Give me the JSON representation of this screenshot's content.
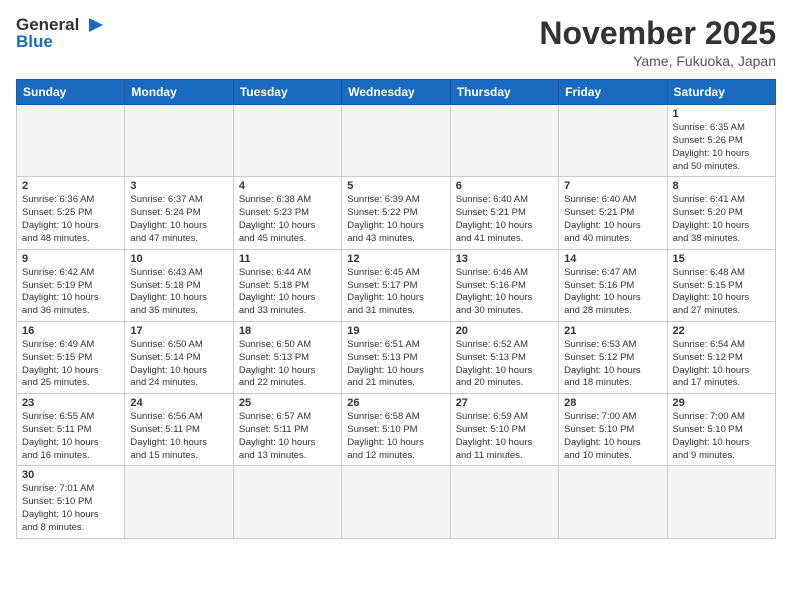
{
  "header": {
    "logo_general": "General",
    "logo_blue": "Blue",
    "title": "November 2025",
    "location": "Yame, Fukuoka, Japan"
  },
  "days_of_week": [
    "Sunday",
    "Monday",
    "Tuesday",
    "Wednesday",
    "Thursday",
    "Friday",
    "Saturday"
  ],
  "weeks": [
    [
      {
        "day": "",
        "info": ""
      },
      {
        "day": "",
        "info": ""
      },
      {
        "day": "",
        "info": ""
      },
      {
        "day": "",
        "info": ""
      },
      {
        "day": "",
        "info": ""
      },
      {
        "day": "",
        "info": ""
      },
      {
        "day": "1",
        "info": "Sunrise: 6:35 AM\nSunset: 5:26 PM\nDaylight: 10 hours\nand 50 minutes."
      }
    ],
    [
      {
        "day": "2",
        "info": "Sunrise: 6:36 AM\nSunset: 5:25 PM\nDaylight: 10 hours\nand 48 minutes."
      },
      {
        "day": "3",
        "info": "Sunrise: 6:37 AM\nSunset: 5:24 PM\nDaylight: 10 hours\nand 47 minutes."
      },
      {
        "day": "4",
        "info": "Sunrise: 6:38 AM\nSunset: 5:23 PM\nDaylight: 10 hours\nand 45 minutes."
      },
      {
        "day": "5",
        "info": "Sunrise: 6:39 AM\nSunset: 5:22 PM\nDaylight: 10 hours\nand 43 minutes."
      },
      {
        "day": "6",
        "info": "Sunrise: 6:40 AM\nSunset: 5:21 PM\nDaylight: 10 hours\nand 41 minutes."
      },
      {
        "day": "7",
        "info": "Sunrise: 6:40 AM\nSunset: 5:21 PM\nDaylight: 10 hours\nand 40 minutes."
      },
      {
        "day": "8",
        "info": "Sunrise: 6:41 AM\nSunset: 5:20 PM\nDaylight: 10 hours\nand 38 minutes."
      }
    ],
    [
      {
        "day": "9",
        "info": "Sunrise: 6:42 AM\nSunset: 5:19 PM\nDaylight: 10 hours\nand 36 minutes."
      },
      {
        "day": "10",
        "info": "Sunrise: 6:43 AM\nSunset: 5:18 PM\nDaylight: 10 hours\nand 35 minutes."
      },
      {
        "day": "11",
        "info": "Sunrise: 6:44 AM\nSunset: 5:18 PM\nDaylight: 10 hours\nand 33 minutes."
      },
      {
        "day": "12",
        "info": "Sunrise: 6:45 AM\nSunset: 5:17 PM\nDaylight: 10 hours\nand 31 minutes."
      },
      {
        "day": "13",
        "info": "Sunrise: 6:46 AM\nSunset: 5:16 PM\nDaylight: 10 hours\nand 30 minutes."
      },
      {
        "day": "14",
        "info": "Sunrise: 6:47 AM\nSunset: 5:16 PM\nDaylight: 10 hours\nand 28 minutes."
      },
      {
        "day": "15",
        "info": "Sunrise: 6:48 AM\nSunset: 5:15 PM\nDaylight: 10 hours\nand 27 minutes."
      }
    ],
    [
      {
        "day": "16",
        "info": "Sunrise: 6:49 AM\nSunset: 5:15 PM\nDaylight: 10 hours\nand 25 minutes."
      },
      {
        "day": "17",
        "info": "Sunrise: 6:50 AM\nSunset: 5:14 PM\nDaylight: 10 hours\nand 24 minutes."
      },
      {
        "day": "18",
        "info": "Sunrise: 6:50 AM\nSunset: 5:13 PM\nDaylight: 10 hours\nand 22 minutes."
      },
      {
        "day": "19",
        "info": "Sunrise: 6:51 AM\nSunset: 5:13 PM\nDaylight: 10 hours\nand 21 minutes."
      },
      {
        "day": "20",
        "info": "Sunrise: 6:52 AM\nSunset: 5:13 PM\nDaylight: 10 hours\nand 20 minutes."
      },
      {
        "day": "21",
        "info": "Sunrise: 6:53 AM\nSunset: 5:12 PM\nDaylight: 10 hours\nand 18 minutes."
      },
      {
        "day": "22",
        "info": "Sunrise: 6:54 AM\nSunset: 5:12 PM\nDaylight: 10 hours\nand 17 minutes."
      }
    ],
    [
      {
        "day": "23",
        "info": "Sunrise: 6:55 AM\nSunset: 5:11 PM\nDaylight: 10 hours\nand 16 minutes."
      },
      {
        "day": "24",
        "info": "Sunrise: 6:56 AM\nSunset: 5:11 PM\nDaylight: 10 hours\nand 15 minutes."
      },
      {
        "day": "25",
        "info": "Sunrise: 6:57 AM\nSunset: 5:11 PM\nDaylight: 10 hours\nand 13 minutes."
      },
      {
        "day": "26",
        "info": "Sunrise: 6:58 AM\nSunset: 5:10 PM\nDaylight: 10 hours\nand 12 minutes."
      },
      {
        "day": "27",
        "info": "Sunrise: 6:59 AM\nSunset: 5:10 PM\nDaylight: 10 hours\nand 11 minutes."
      },
      {
        "day": "28",
        "info": "Sunrise: 7:00 AM\nSunset: 5:10 PM\nDaylight: 10 hours\nand 10 minutes."
      },
      {
        "day": "29",
        "info": "Sunrise: 7:00 AM\nSunset: 5:10 PM\nDaylight: 10 hours\nand 9 minutes."
      }
    ],
    [
      {
        "day": "30",
        "info": "Sunrise: 7:01 AM\nSunset: 5:10 PM\nDaylight: 10 hours\nand 8 minutes."
      },
      {
        "day": "",
        "info": ""
      },
      {
        "day": "",
        "info": ""
      },
      {
        "day": "",
        "info": ""
      },
      {
        "day": "",
        "info": ""
      },
      {
        "day": "",
        "info": ""
      },
      {
        "day": "",
        "info": ""
      }
    ]
  ]
}
